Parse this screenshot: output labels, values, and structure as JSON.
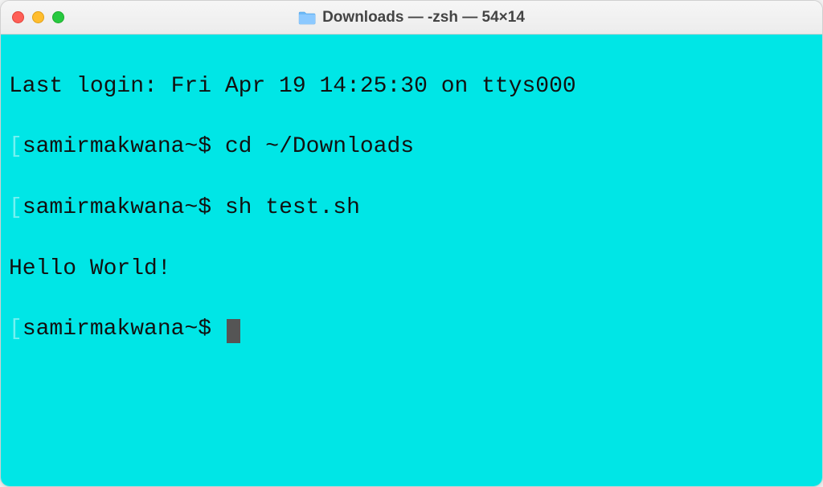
{
  "window": {
    "title": "Downloads — -zsh — 54×14"
  },
  "terminal": {
    "last_login": "Last login: Fri Apr 19 14:25:30 on ttys000",
    "prompt_1": "samirmakwana~$ ",
    "command_1": "cd ~/Downloads",
    "prompt_2": "samirmakwana~$ ",
    "command_2": "sh test.sh",
    "output_1": "Hello World!",
    "prompt_3": "samirmakwana~$ "
  },
  "colors": {
    "terminal_bg": "#00e6e6",
    "text": "#111111"
  }
}
